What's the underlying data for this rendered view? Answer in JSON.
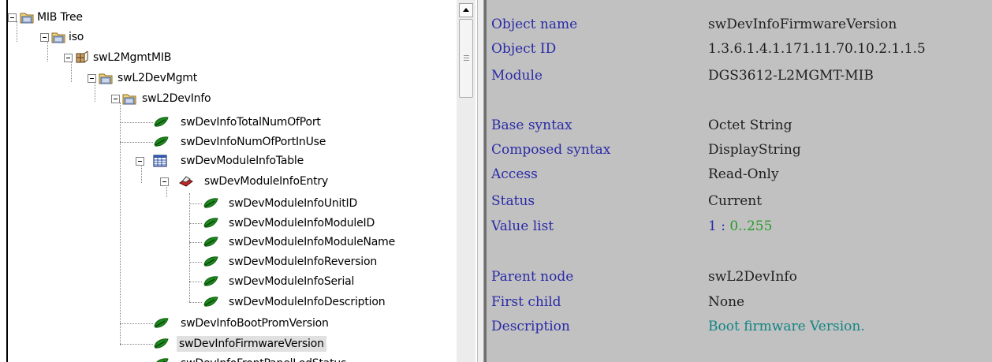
{
  "tree": {
    "nodes": [
      {
        "id": "mib-tree",
        "label": "MIB Tree",
        "icon": "folder-icon"
      },
      {
        "id": "iso",
        "label": "iso",
        "icon": "folder-icon"
      },
      {
        "id": "swl2mgmtmib",
        "label": "swL2MgmtMIB",
        "icon": "module-icon"
      },
      {
        "id": "swl2devmgmt",
        "label": "swL2DevMgmt",
        "icon": "folder-icon"
      },
      {
        "id": "swl2devinfo",
        "label": "swL2DevInfo",
        "icon": "folder-icon"
      },
      {
        "id": "totalnumofport",
        "label": "swDevInfoTotalNumOfPort",
        "icon": "leaf-icon"
      },
      {
        "id": "numofportinuse",
        "label": "swDevInfoNumOfPortInUse",
        "icon": "leaf-icon"
      },
      {
        "id": "moduleinfotable",
        "label": "swDevModuleInfoTable",
        "icon": "table-icon"
      },
      {
        "id": "moduleinfoentry",
        "label": "swDevModuleInfoEntry",
        "icon": "entry-icon"
      },
      {
        "id": "unitid",
        "label": "swDevModuleInfoUnitID",
        "icon": "leaf-icon"
      },
      {
        "id": "moduleid",
        "label": "swDevModuleInfoModuleID",
        "icon": "leaf-icon"
      },
      {
        "id": "modulename",
        "label": "swDevModuleInfoModuleName",
        "icon": "leaf-icon"
      },
      {
        "id": "reversion",
        "label": "swDevModuleInfoReversion",
        "icon": "leaf-icon"
      },
      {
        "id": "serial",
        "label": "swDevModuleInfoSerial",
        "icon": "leaf-icon"
      },
      {
        "id": "description",
        "label": "swDevModuleInfoDescription",
        "icon": "leaf-icon"
      },
      {
        "id": "bootpromversion",
        "label": "swDevInfoBootPromVersion",
        "icon": "leaf-icon"
      },
      {
        "id": "firmwareversion",
        "label": "swDevInfoFirmwareVersion",
        "icon": "leaf-icon",
        "selected": true
      },
      {
        "id": "frontpanelledstatus",
        "label": "swDevInfoFrontPanelLedStatus",
        "icon": "leaf-icon"
      }
    ]
  },
  "details": {
    "object_name": {
      "label": "Object name",
      "value": "swDevInfoFirmwareVersion"
    },
    "object_id": {
      "label": "Object ID",
      "value": "1.3.6.1.4.1.171.11.70.10.2.1.1.5"
    },
    "module": {
      "label": "Module",
      "value": "DGS3612-L2MGMT-MIB"
    },
    "base_syntax": {
      "label": "Base syntax",
      "value": "Octet String"
    },
    "composed_syntax": {
      "label": "Composed syntax",
      "value": "DisplayString"
    },
    "access": {
      "label": "Access",
      "value": "Read-Only"
    },
    "status": {
      "label": "Status",
      "value": "Current"
    },
    "value_list": {
      "label": "Value list",
      "index": "1 : ",
      "range": "0..255"
    },
    "parent_node": {
      "label": "Parent node",
      "value": "swL2DevInfo"
    },
    "first_child": {
      "label": "First child",
      "value": "None"
    },
    "description": {
      "label": "Description",
      "value": "Boot firmware Version."
    }
  },
  "colors": {
    "panel_bg": "#c1c1c1",
    "key_text": "#2a2aa8",
    "desc_text": "#128484",
    "range_text": "#2a9a2a",
    "leaf_green": "#1e8a1e"
  }
}
